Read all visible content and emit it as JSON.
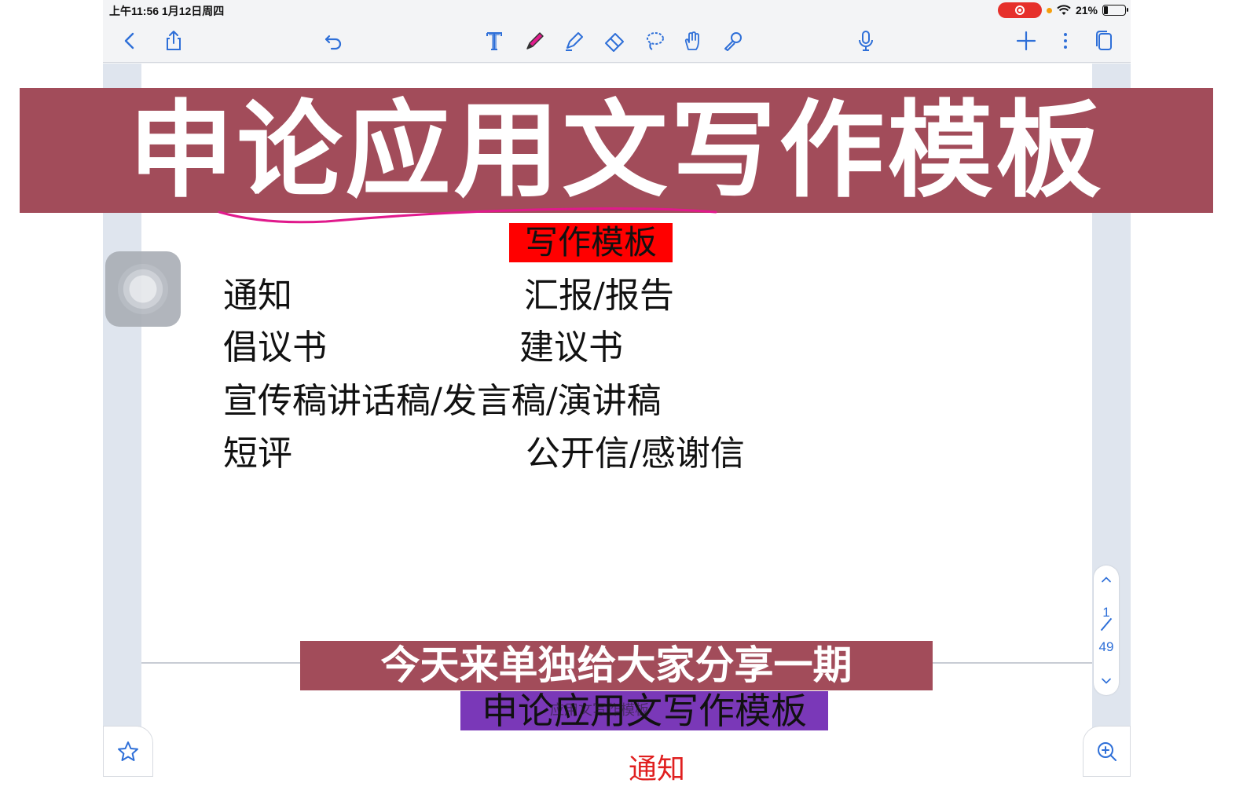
{
  "status_bar": {
    "time_date": "上午11:56   1月12日周四",
    "battery_percent": "21%",
    "battery_level": 0.21
  },
  "toolbar": {
    "left": [
      "back-icon",
      "share-icon",
      "undo-icon"
    ],
    "tools": [
      "text-tool-icon",
      "pen-icon",
      "highlighter-icon",
      "eraser-icon",
      "lasso-icon",
      "hand-icon",
      "laser-pointer-icon"
    ],
    "right": [
      "microphone-icon",
      "add-icon",
      "more-icon",
      "pages-icon"
    ]
  },
  "banner": {
    "title": "申论应用文写作模板"
  },
  "document": {
    "section_label": "写作模板",
    "items": [
      "通知",
      "汇报/报告",
      "倡议书",
      "建议书",
      "宣传稿讲话稿/发言稿/演讲稿",
      "短评",
      "公开信/感谢信"
    ],
    "next_heading": "通知"
  },
  "pager": {
    "current": "1",
    "total": "49"
  },
  "subtitles": {
    "line1": "今天来单独给大家分享一期",
    "line2": "申论应用文写作模板",
    "ghost_text": "应用文写作模板"
  },
  "colors": {
    "banner_bg": "#a24c5a",
    "label_bg": "#ff0000",
    "purple_bg": "#7a38b8",
    "accent_blue": "#2e6fd8",
    "pen_pink": "#e01a8c"
  }
}
